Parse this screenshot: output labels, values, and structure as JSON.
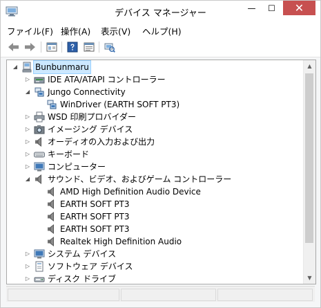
{
  "window": {
    "title": "デバイス マネージャー",
    "minimize_label": "—",
    "maximize_label": "☐",
    "close_label": "✕"
  },
  "menu": [
    {
      "label": "ファイル(F)"
    },
    {
      "label": "操作(A)"
    },
    {
      "label": "表示(V)"
    },
    {
      "label": "ヘルプ(H)"
    }
  ],
  "toolbar": {
    "buttons": [
      {
        "name": "back-button",
        "icon": "arrow-left-icon"
      },
      {
        "name": "forward-button",
        "icon": "arrow-right-icon"
      },
      {
        "name": "show-hide-console-tree-button",
        "icon": "console-tree-icon"
      },
      {
        "name": "help-button",
        "icon": "help-icon"
      },
      {
        "name": "properties-button",
        "icon": "properties-icon"
      },
      {
        "name": "scan-hardware-button",
        "icon": "scan-hardware-icon"
      }
    ]
  },
  "tree": {
    "items": [
      {
        "label": "Bunbunmaru",
        "level": 0,
        "expander": "expanded",
        "icon": "computer-icon",
        "selected": true
      },
      {
        "label": "IDE ATA/ATAPI コントローラー",
        "level": 1,
        "expander": "collapsed",
        "icon": "ide-controller-icon"
      },
      {
        "label": "Jungo Connectivity",
        "level": 1,
        "expander": "expanded",
        "icon": "jungo-icon"
      },
      {
        "label": "WinDriver (EARTH SOFT PT3)",
        "level": 2,
        "expander": "none",
        "icon": "jungo-icon"
      },
      {
        "label": "WSD 印刷プロバイダー",
        "level": 1,
        "expander": "collapsed",
        "icon": "printer-icon"
      },
      {
        "label": "イメージング デバイス",
        "level": 1,
        "expander": "collapsed",
        "icon": "camera-icon"
      },
      {
        "label": "オーディオの入力および出力",
        "level": 1,
        "expander": "collapsed",
        "icon": "speaker-icon"
      },
      {
        "label": "キーボード",
        "level": 1,
        "expander": "collapsed",
        "icon": "keyboard-icon"
      },
      {
        "label": "コンピューター",
        "level": 1,
        "expander": "collapsed",
        "icon": "monitor-icon"
      },
      {
        "label": "サウンド、ビデオ、およびゲーム コントローラー",
        "level": 1,
        "expander": "expanded",
        "icon": "speaker-icon"
      },
      {
        "label": "AMD High Definition Audio Device",
        "level": 2,
        "expander": "none",
        "icon": "speaker-icon"
      },
      {
        "label": "EARTH SOFT PT3",
        "level": 2,
        "expander": "none",
        "icon": "speaker-icon"
      },
      {
        "label": "EARTH SOFT PT3",
        "level": 2,
        "expander": "none",
        "icon": "speaker-icon"
      },
      {
        "label": "EARTH SOFT PT3",
        "level": 2,
        "expander": "none",
        "icon": "speaker-icon"
      },
      {
        "label": "Realtek High Definition Audio",
        "level": 2,
        "expander": "none",
        "icon": "speaker-icon"
      },
      {
        "label": "システム デバイス",
        "level": 1,
        "expander": "collapsed",
        "icon": "monitor-icon"
      },
      {
        "label": "ソフトウェア デバイス",
        "level": 1,
        "expander": "collapsed",
        "icon": "software-device-icon"
      },
      {
        "label": "ディスク ドライブ",
        "level": 1,
        "expander": "collapsed",
        "icon": "disk-drive-icon"
      }
    ]
  },
  "colors": {
    "close_button": "#c75050",
    "selection": "#cce8ff"
  }
}
